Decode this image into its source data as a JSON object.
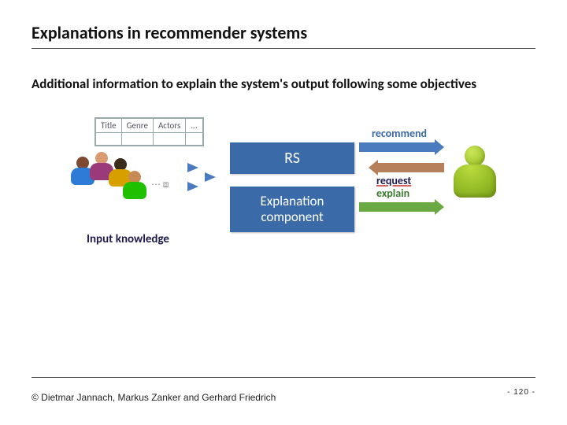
{
  "title": "Explanations in recommender systems",
  "subtitle": "Additional information to explain the system's output following some objectives",
  "diagram": {
    "table_headers": [
      "Title",
      "Genre",
      "Actors",
      "..."
    ],
    "misc_glyphs": "⋯  ⧈",
    "rs_label": "RS",
    "explanation_label": "Explanation component",
    "input_knowledge": "Input knowledge",
    "arrows": {
      "recommend": "recommend",
      "request": "request",
      "explain": "explain"
    }
  },
  "footer": "© Dietmar Jannach, Markus Zanker and Gerhard Friedrich",
  "page_number": "- 120 -"
}
